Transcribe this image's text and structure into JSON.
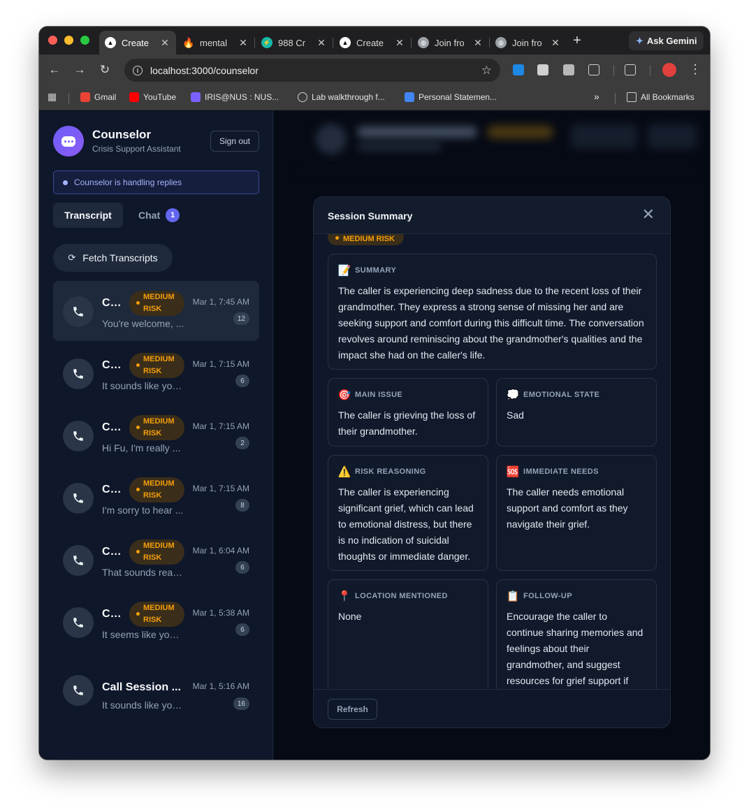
{
  "browser": {
    "tabs": [
      {
        "label": "Create",
        "icon": "vercel-icon",
        "active": true
      },
      {
        "label": "mental",
        "icon": "flame-icon"
      },
      {
        "label": "988 Cr",
        "icon": "bolt-icon"
      },
      {
        "label": "Create",
        "icon": "vercel-icon"
      },
      {
        "label": "Join fro",
        "icon": "globe-icon"
      },
      {
        "label": "Join fro",
        "icon": "globe-icon"
      }
    ],
    "gemini_label": "Ask Gemini",
    "url": "localhost:3000/counselor",
    "bookmarks": [
      {
        "label": "Gmail"
      },
      {
        "label": "YouTube"
      },
      {
        "label": "IRIS@NUS : NUS..."
      },
      {
        "label": "Lab walkthrough f..."
      },
      {
        "label": "Personal Statemen..."
      }
    ],
    "all_bookmarks_label": "All Bookmarks"
  },
  "sidebar": {
    "brand_title": "Counselor",
    "brand_subtitle": "Crisis Support Assistant",
    "signout_label": "Sign out",
    "banner_text": "Counselor is handling replies",
    "tab_transcript": "Transcript",
    "tab_chat": "Chat",
    "chat_count": "1",
    "fetch_label": "Fetch Transcripts",
    "risk_line1": "MEDIUM",
    "risk_line2": "RISK",
    "sessions": [
      {
        "title": "Call Session",
        "date": "Mar 1, 7:45 AM",
        "count": "12",
        "preview": "You're welcome, ...",
        "risk": true
      },
      {
        "title": "Call Session",
        "date": "Mar 1, 7:15 AM",
        "count": "6",
        "preview": "It sounds like you're ...",
        "risk": true
      },
      {
        "title": "Call Session",
        "date": "Mar 1, 7:15 AM",
        "count": "2",
        "preview": "Hi Fu, I'm really ...",
        "risk": true
      },
      {
        "title": "Call Session",
        "date": "Mar 1, 7:15 AM",
        "count": "8",
        "preview": "I'm sorry to hear ...",
        "risk": true
      },
      {
        "title": "Call Session",
        "date": "Mar 1, 6:04 AM",
        "count": "6",
        "preview": "That sounds really ...",
        "risk": true
      },
      {
        "title": "Call Session",
        "date": "Mar 1, 5:38 AM",
        "count": "6",
        "preview": "It seems like you ...",
        "risk": true
      },
      {
        "title": "Call Session ...",
        "date": "Mar 1, 5:16 AM",
        "count": "16",
        "preview": "It sounds like you ...",
        "risk": false
      }
    ]
  },
  "modal": {
    "title": "Session Summary",
    "risk_label": "MEDIUM RISK",
    "summary_label": "SUMMARY",
    "summary_text": "The caller is experiencing deep sadness due to the recent loss of their grandmother. They express a strong sense of missing her and are seeking support and comfort during this difficult time. The conversation revolves around reminiscing about the grandmother's qualities and the impact she had on the caller's life.",
    "main_issue_label": "MAIN ISSUE",
    "main_issue_text": "The caller is grieving the loss of their grandmother.",
    "emotional_state_label": "EMOTIONAL STATE",
    "emotional_state_text": "Sad",
    "risk_reasoning_label": "RISK REASONING",
    "risk_reasoning_text": "The caller is experiencing significant grief, which can lead to emotional distress, but there is no indication of suicidal thoughts or immediate danger.",
    "immediate_needs_label": "IMMEDIATE NEEDS",
    "immediate_needs_text": "The caller needs emotional support and comfort as they navigate their grief.",
    "location_label": "LOCATION MENTIONED",
    "location_text": "None",
    "followup_label": "FOLLOW-UP",
    "followup_text": "Encourage the caller to continue sharing memories and feelings about their grandmother, and suggest resources for grief support if",
    "refresh_label": "Refresh"
  },
  "colors": {
    "accent": "#6366f1",
    "risk_medium": "#f59e0b",
    "background": "#0f172a"
  }
}
